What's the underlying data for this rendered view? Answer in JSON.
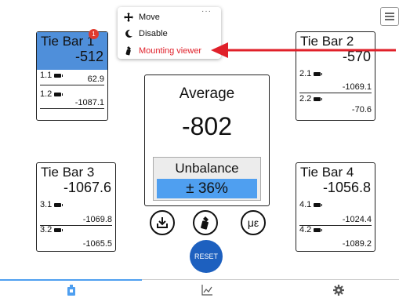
{
  "cards": [
    {
      "id": "1",
      "title": "Tie Bar 1",
      "value": "-512",
      "sensors": [
        {
          "label": "1.1",
          "value": "62.9"
        },
        {
          "label": "1.2",
          "value": "-1087.1"
        }
      ]
    },
    {
      "id": "2",
      "title": "Tie Bar 2",
      "value": "-570",
      "sensors": [
        {
          "label": "2.1",
          "value": "-1069.1"
        },
        {
          "label": "2.2",
          "value": "-70.6"
        }
      ]
    },
    {
      "id": "3",
      "title": "Tie Bar 3",
      "value": "-1067.6",
      "sensors": [
        {
          "label": "3.1",
          "value": "-1069.8"
        },
        {
          "label": "3.2",
          "value": "-1065.5"
        }
      ]
    },
    {
      "id": "4",
      "title": "Tie Bar 4",
      "value": "-1056.8",
      "sensors": [
        {
          "label": "4.1",
          "value": "-1024.4"
        },
        {
          "label": "4.2",
          "value": "-1089.2"
        }
      ]
    }
  ],
  "badge_count": "1",
  "average": {
    "title": "Average",
    "value": "-802"
  },
  "unbalance": {
    "title": "Unbalance",
    "value": "± 36%"
  },
  "actions": {
    "microstrain_label": "με",
    "reset_label": "RESET"
  },
  "menu": {
    "dots": "···",
    "items": [
      {
        "label": "Move",
        "icon": "move-arrows-icon"
      },
      {
        "label": "Disable",
        "icon": "moon-icon"
      },
      {
        "label": "Mounting viewer",
        "icon": "sensor-mount-icon"
      }
    ]
  },
  "colors": {
    "accent": "#4f9ff0",
    "selected_header": "#4f8fda",
    "reset": "#1d60bf",
    "highlight": "#e0202a",
    "arrow": "#e0202a"
  },
  "tabs": [
    {
      "name": "sensor-tab",
      "icon": "sensor-icon",
      "active": true
    },
    {
      "name": "chart-tab",
      "icon": "chart-icon",
      "active": false
    },
    {
      "name": "settings-tab",
      "icon": "gear-icon",
      "active": false
    }
  ]
}
